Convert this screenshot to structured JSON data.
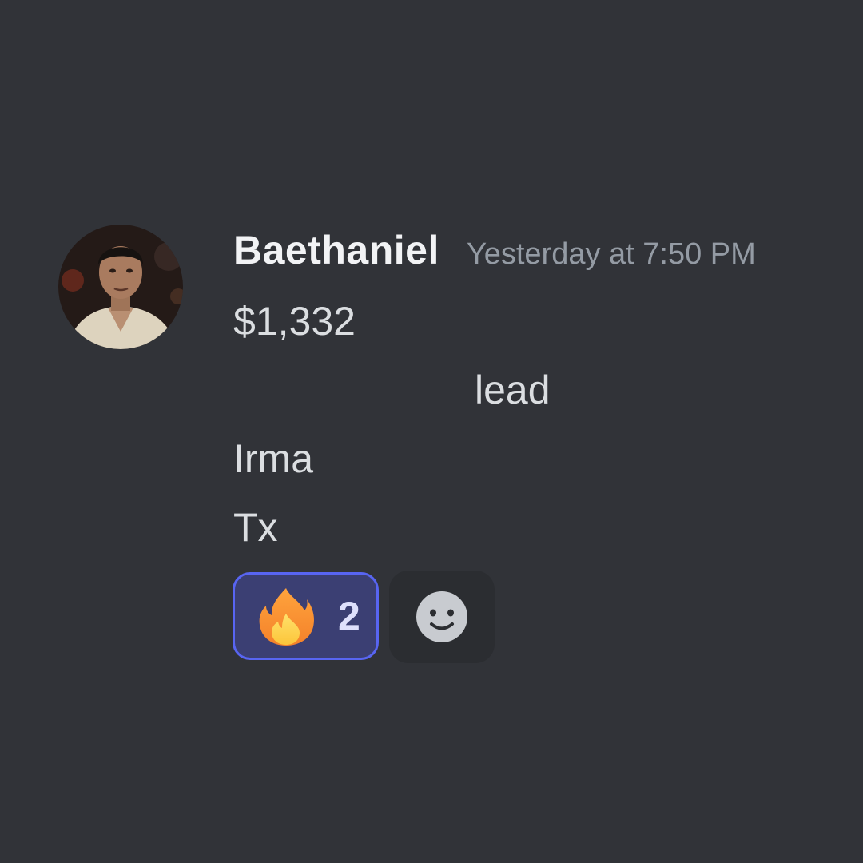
{
  "message": {
    "author": {
      "username": "Baethaniel",
      "avatar": "user-avatar"
    },
    "timestamp": "Yesterday at 7:50 PM",
    "lines": [
      "$1,332",
      "lead",
      "Irma",
      "Tx"
    ],
    "reactions": [
      {
        "emoji": "fire-emoji",
        "count": "2",
        "reacted": true
      }
    ],
    "add_reaction_icon": "smiley-face-icon"
  },
  "colors": {
    "background": "#313338",
    "username": "#f2f3f5",
    "timestamp": "#949ba4",
    "text": "#dbdee1",
    "reaction_border": "#5865f2",
    "reaction_background": "#3b3f73",
    "add_reaction_background": "#2b2d31"
  }
}
